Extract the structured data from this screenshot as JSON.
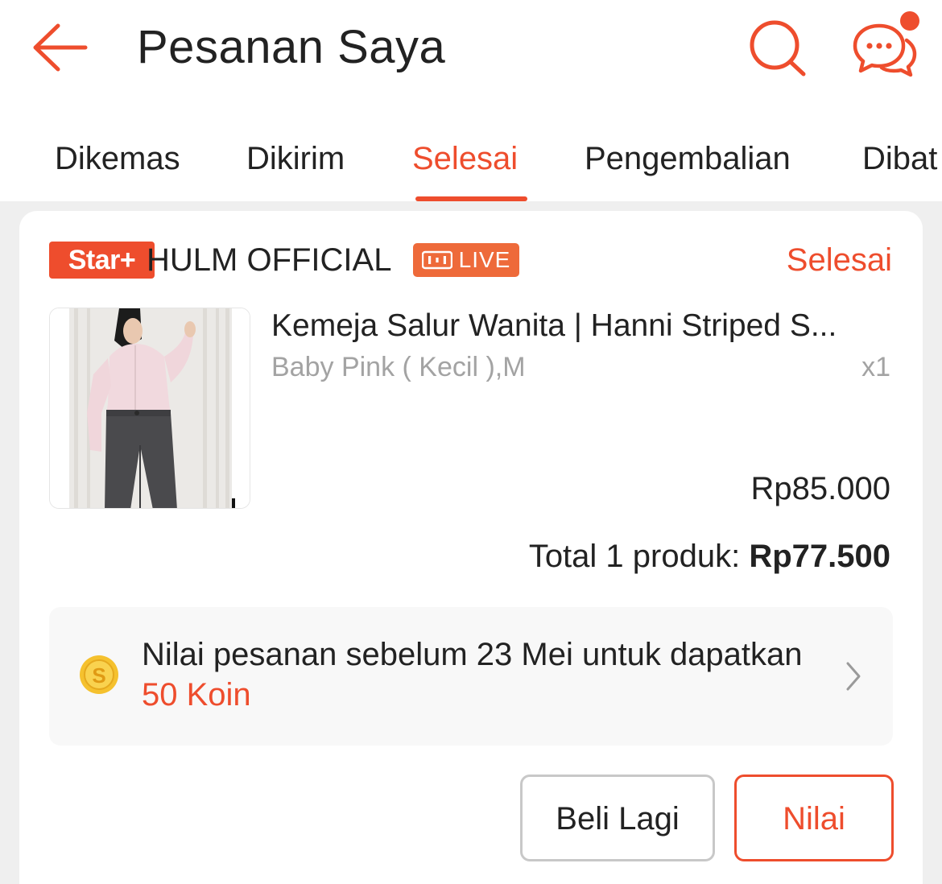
{
  "header": {
    "title": "Pesanan Saya",
    "back_icon": "arrow-left-icon",
    "search_icon": "search-icon",
    "chat_icon": "chat-bubbles-icon",
    "has_notification": true
  },
  "tabs": [
    {
      "label": "Dikemas",
      "active": false
    },
    {
      "label": "Dikirim",
      "active": false
    },
    {
      "label": "Selesai",
      "active": true
    },
    {
      "label": "Pengembalian",
      "active": false
    },
    {
      "label": "Dibat",
      "active": false
    }
  ],
  "order": {
    "shop_badge": "Star+",
    "shop_name": "HULM OFFICIAL",
    "live_badge": "LIVE",
    "status": "Selesai",
    "product": {
      "name": "Kemeja Salur Wanita | Hanni Striped S...",
      "variant": "Baby Pink ( Kecil ),M",
      "quantity": "x1",
      "price": "Rp85.000"
    },
    "total_label": "Total 1 produk:",
    "total_amount": "Rp77.500",
    "coin_banner": {
      "text_prefix": "Nilai pesanan sebelum 23 Mei untuk dapatkan",
      "coin_amount": "50 Koin",
      "icon": "coin-icon"
    },
    "buttons": {
      "buy_again": "Beli Lagi",
      "rate": "Nilai"
    }
  },
  "colors": {
    "accent": "#ee4d2d",
    "live": "#ee6a3a",
    "background": "#efefef",
    "muted_text": "#a3a3a3"
  }
}
